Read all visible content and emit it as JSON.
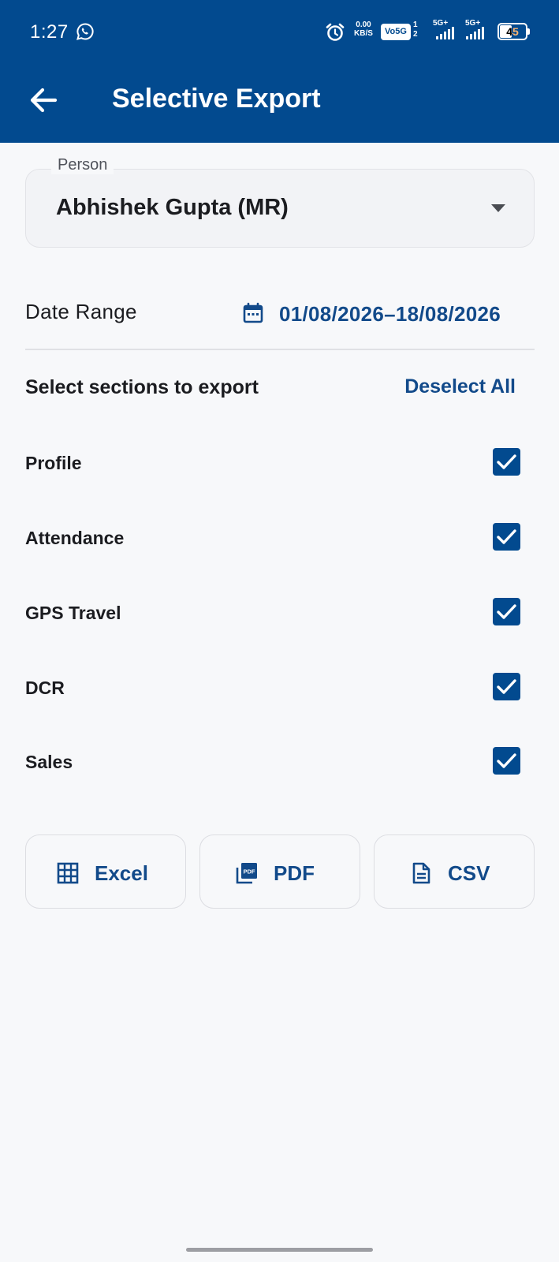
{
  "status_bar": {
    "time": "1:27",
    "net_speed_value": "0.00",
    "net_speed_unit": "KB/S",
    "volte": "Vo5G",
    "sim_slot_1": "1",
    "sim_slot_2": "2",
    "signal_1_label": "5G+",
    "signal_2_label": "5G+",
    "battery": "45",
    "icons": [
      "whatsapp-icon",
      "alarm-icon",
      "signal-icon",
      "battery-icon"
    ]
  },
  "app_bar": {
    "title": "Selective Export",
    "back_icon": "arrow-left-icon",
    "background_color": "#024a8f"
  },
  "person": {
    "label": "Person",
    "value": "Abhishek Gupta (MR)",
    "icon": "dropdown-caret-icon"
  },
  "date_range": {
    "label": "Date Range",
    "value": "01/08/2026–18/08/2026",
    "icon": "calendar-icon"
  },
  "sections": {
    "heading": "Select sections to export",
    "deselect_label": "Deselect All",
    "items": [
      {
        "label": "Profile",
        "checked": true
      },
      {
        "label": "Attendance",
        "checked": true
      },
      {
        "label": "GPS Travel",
        "checked": true
      },
      {
        "label": "DCR",
        "checked": true
      },
      {
        "label": "Sales",
        "checked": true
      }
    ]
  },
  "export_buttons": [
    {
      "label": "Excel",
      "icon": "table-grid-icon"
    },
    {
      "label": "PDF",
      "icon": "pdf-file-icon"
    },
    {
      "label": "CSV",
      "icon": "document-icon"
    }
  ],
  "colors": {
    "primary": "#024a8f",
    "accent_text": "#124a8a",
    "background": "#f7f8fa"
  }
}
